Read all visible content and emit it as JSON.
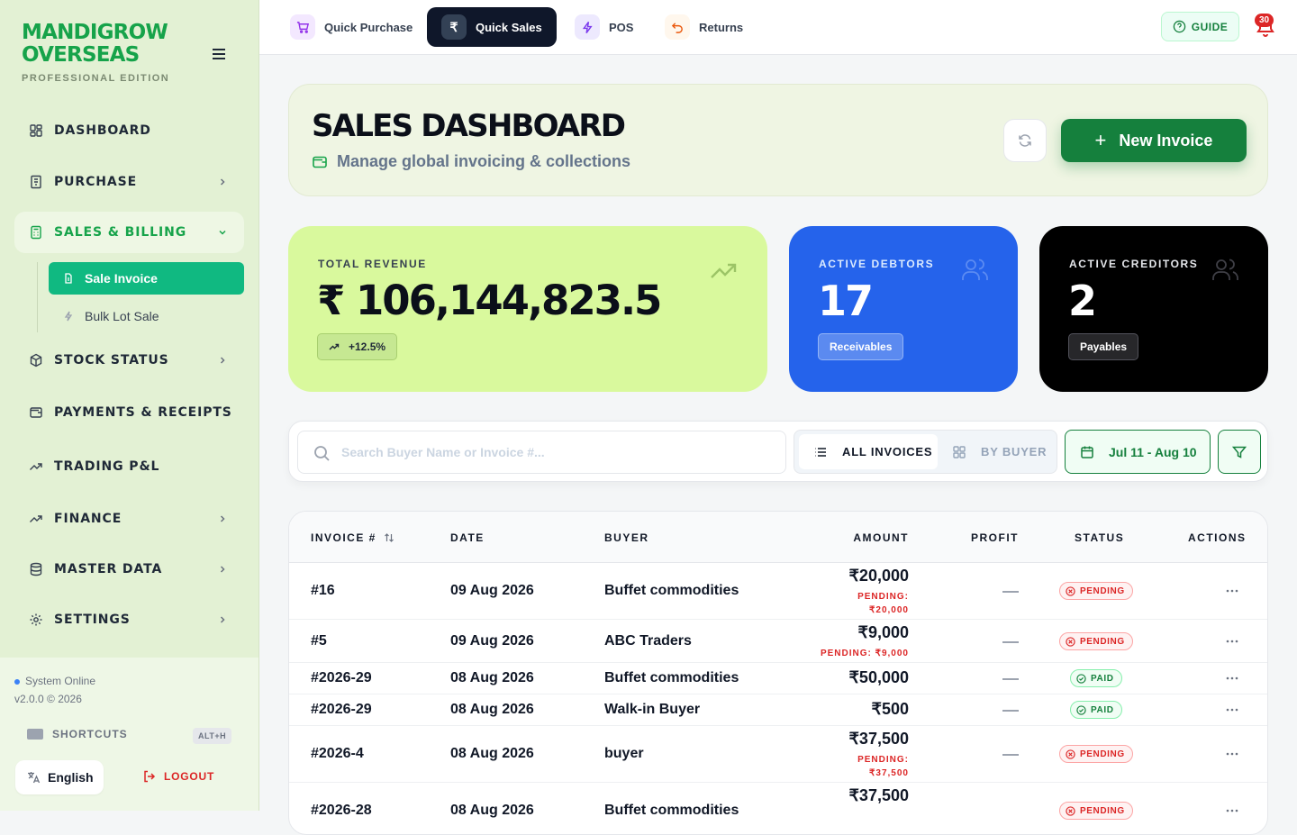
{
  "sidebar": {
    "brand": "MANDIGROW OVERSEAS",
    "edition": "PROFESSIONAL EDITION",
    "items": [
      {
        "label": "DASHBOARD"
      },
      {
        "label": "PURCHASE"
      },
      {
        "label": "SALES & BILLING"
      },
      {
        "label": "STOCK STATUS"
      },
      {
        "label": "PAYMENTS & RECEIPTS"
      },
      {
        "label": "TRADING P&L"
      },
      {
        "label": "FINANCE"
      },
      {
        "label": "MASTER DATA"
      },
      {
        "label": "SETTINGS"
      }
    ],
    "sub_items": [
      {
        "label": "Sale Invoice"
      },
      {
        "label": "Bulk Lot Sale"
      }
    ],
    "status_text": "System Online",
    "version": "v2.0.0 © 2026",
    "shortcuts_label": "SHORTCUTS",
    "shortcuts_hint": "ALT+H",
    "language": "English",
    "logout_label": "LOGOUT"
  },
  "topbar": {
    "buttons": [
      {
        "label": "Quick Purchase"
      },
      {
        "label": "Quick Sales"
      },
      {
        "label": "POS"
      },
      {
        "label": "Returns"
      }
    ],
    "guide_label": "GUIDE",
    "notification_count": "30"
  },
  "hero": {
    "title": "SALES DASHBOARD",
    "subtitle": "Manage global invoicing & collections",
    "new_invoice_label": "New Invoice"
  },
  "stats": {
    "revenue": {
      "label": "TOTAL REVENUE",
      "value": "₹ 106,144,823.5",
      "change": "+12.5%"
    },
    "debtors": {
      "label": "ACTIVE DEBTORS",
      "value": "17",
      "pill": "Receivables"
    },
    "creditors": {
      "label": "ACTIVE CREDITORS",
      "value": "2",
      "pill": "Payables"
    }
  },
  "toolbar": {
    "search_placeholder": "Search Buyer Name or Invoice #...",
    "view_all": "ALL INVOICES",
    "view_buyer": "BY BUYER",
    "date_range": "Jul 11 - Aug 10"
  },
  "table": {
    "headers": {
      "invoice": "INVOICE #",
      "date": "DATE",
      "buyer": "BUYER",
      "amount": "AMOUNT",
      "profit": "PROFIT",
      "status": "STATUS",
      "actions": "ACTIONS"
    },
    "rows": [
      {
        "invoice": "#16",
        "date": "09 Aug 2026",
        "buyer": "Buffet commodities",
        "amount": "₹20,000",
        "pending_l1": "PENDING:",
        "pending_l2": "₹20,000",
        "status": "PENDING"
      },
      {
        "invoice": "#5",
        "date": "09 Aug 2026",
        "buyer": "ABC Traders",
        "amount": "₹9,000",
        "pending_l1": "PENDING: ₹9,000",
        "status": "PENDING"
      },
      {
        "invoice": "#2026-29",
        "date": "08 Aug 2026",
        "buyer": "Buffet commodities",
        "amount": "₹50,000",
        "status": "PAID"
      },
      {
        "invoice": "#2026-29",
        "date": "08 Aug 2026",
        "buyer": "Walk-in Buyer",
        "amount": "₹500",
        "status": "PAID"
      },
      {
        "invoice": "#2026-4",
        "date": "08 Aug 2026",
        "buyer": "buyer",
        "amount": "₹37,500",
        "pending_l1": "PENDING:",
        "pending_l2": "₹37,500",
        "status": "PENDING"
      },
      {
        "invoice": "#2026-28",
        "date": "08 Aug 2026",
        "buyer": "Buffet commodities",
        "amount": "₹37,500",
        "status": "PENDING"
      }
    ]
  },
  "colors": {
    "brand": "#16a34a",
    "revenue_card": "#d9f99d",
    "debtors_card": "#2563eb",
    "creditors_card": "#000000",
    "pending": "#dc2626",
    "paid": "#15803d"
  }
}
